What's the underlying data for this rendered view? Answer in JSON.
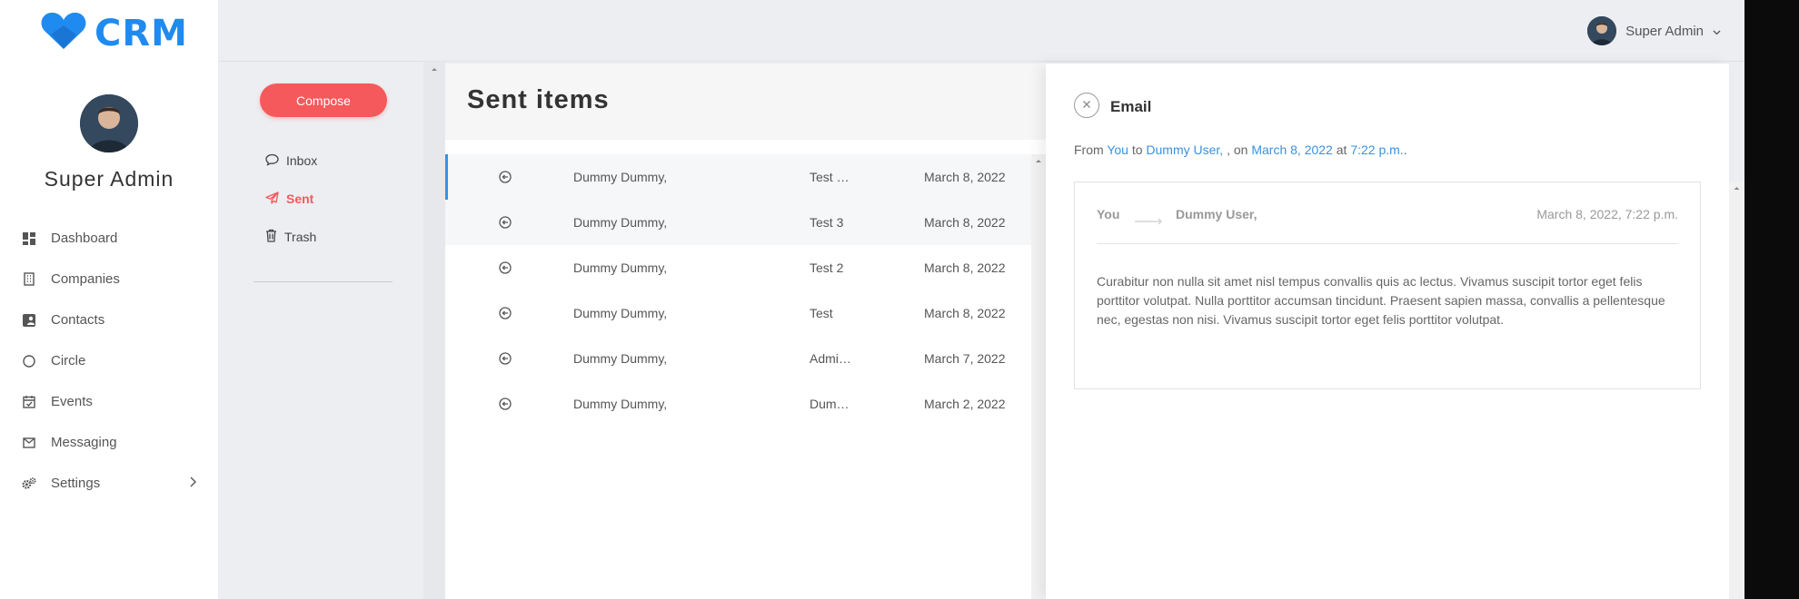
{
  "brand": {
    "logo_text": "CRM",
    "accent": "#1f8bf0"
  },
  "profile": {
    "name": "Super Admin"
  },
  "sidebar": {
    "items": [
      {
        "label": "Dashboard",
        "icon": "dashboard-icon"
      },
      {
        "label": "Companies",
        "icon": "building-icon"
      },
      {
        "label": "Contacts",
        "icon": "contacts-icon"
      },
      {
        "label": "Circle",
        "icon": "circle-icon"
      },
      {
        "label": "Events",
        "icon": "calendar-check-icon"
      },
      {
        "label": "Messaging",
        "icon": "envelope-icon"
      },
      {
        "label": "Settings",
        "icon": "gears-icon",
        "has_submenu": true
      }
    ]
  },
  "header": {
    "user_name": "Super Admin"
  },
  "folders": {
    "compose_label": "Compose",
    "items": [
      {
        "label": "Inbox",
        "icon": "comment-icon",
        "active": false
      },
      {
        "label": "Sent",
        "icon": "paper-plane-icon",
        "active": true
      },
      {
        "label": "Trash",
        "icon": "trash-icon",
        "active": false
      }
    ],
    "compose_color": "#f5595b"
  },
  "list": {
    "title": "Sent items",
    "rows": [
      {
        "from": "Dummy Dummy,",
        "subject": "Test …",
        "date": "March 8, 2022"
      },
      {
        "from": "Dummy Dummy,",
        "subject": "Test 3",
        "date": "March 8, 2022"
      },
      {
        "from": "Dummy Dummy,",
        "subject": "Test 2",
        "date": "March 8, 2022"
      },
      {
        "from": "Dummy Dummy,",
        "subject": "Test",
        "date": "March 8, 2022"
      },
      {
        "from": "Dummy Dummy,",
        "subject": "Admi…",
        "date": "March 7, 2022"
      },
      {
        "from": "Dummy Dummy,",
        "subject": "Dum…",
        "date": "March 2, 2022"
      }
    ]
  },
  "detail": {
    "title": "Email",
    "meta": {
      "from_prefix": "From",
      "from": "You",
      "to_prefix": "to",
      "to": "Dummy User, ",
      "on_prefix": ", on",
      "date": "March 8, 2022",
      "at_prefix": "at",
      "time": "7:22 p.m.",
      "suffix": "."
    },
    "message": {
      "from": "You",
      "to": "Dummy User,",
      "date": "March 8, 2022, 7:22 p.m.",
      "body": "Curabitur non nulla sit amet nisl tempus convallis quis ac lectus. Vivamus suscipit tortor eget felis porttitor volutpat. Nulla porttitor accumsan tincidunt. Praesent sapien massa, convallis a pellentesque nec, egestas non nisi. Vivamus suscipit tortor eget felis porttitor volutpat."
    }
  }
}
